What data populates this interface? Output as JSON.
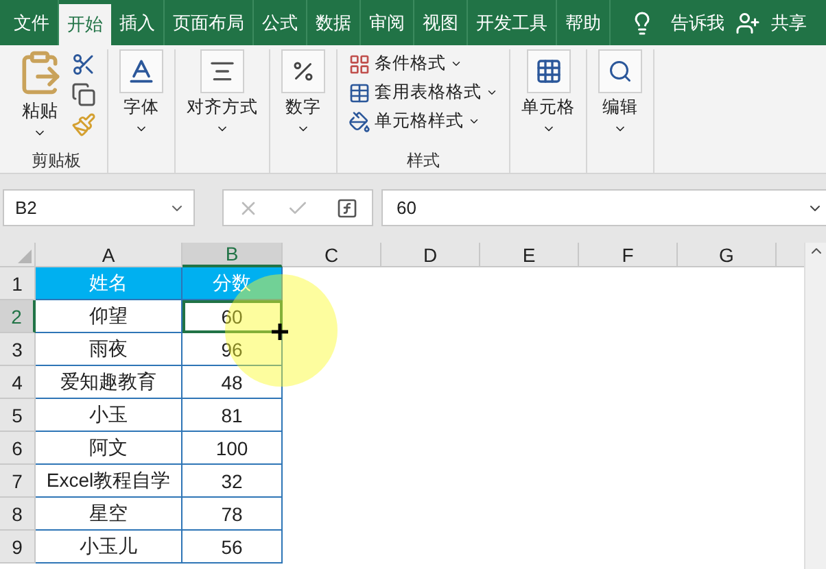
{
  "tabs": [
    {
      "label": "文件",
      "selected": false
    },
    {
      "label": "开始",
      "selected": true
    },
    {
      "label": "插入",
      "selected": false
    },
    {
      "label": "页面布局",
      "selected": false
    },
    {
      "label": "公式",
      "selected": false
    },
    {
      "label": "数据",
      "selected": false
    },
    {
      "label": "审阅",
      "selected": false
    },
    {
      "label": "视图",
      "selected": false
    },
    {
      "label": "开发工具",
      "selected": false
    },
    {
      "label": "帮助",
      "selected": false
    }
  ],
  "tell_me": "告诉我",
  "share": "共享",
  "ribbon": {
    "groups": [
      {
        "kind": "clipboard",
        "paste": "粘贴",
        "label": "剪贴板"
      },
      {
        "kind": "big",
        "label": "字体"
      },
      {
        "kind": "big",
        "label": "对齐方式"
      },
      {
        "kind": "big",
        "label": "数字"
      },
      {
        "kind": "styles",
        "items": [
          "条件格式",
          "套用表格格式",
          "单元格样式"
        ],
        "label": "样式"
      },
      {
        "kind": "big",
        "label": "单元格"
      },
      {
        "kind": "big",
        "label": "编辑"
      }
    ]
  },
  "name_box": "B2",
  "formula": "60",
  "columns": [
    {
      "label": "A",
      "selected": false
    },
    {
      "label": "B",
      "selected": true
    },
    {
      "label": "C",
      "selected": false
    },
    {
      "label": "D",
      "selected": false
    },
    {
      "label": "E",
      "selected": false
    },
    {
      "label": "F",
      "selected": false
    },
    {
      "label": "G",
      "selected": false
    }
  ],
  "rows": [
    {
      "number": "1",
      "kind": "header",
      "selected": false,
      "cells": [
        {
          "text": "姓名",
          "selected": false
        },
        {
          "text": "分数",
          "selected": false
        }
      ]
    },
    {
      "number": "2",
      "kind": "data",
      "selected": true,
      "cells": [
        {
          "text": "仰望",
          "selected": false
        },
        {
          "text": "60",
          "selected": true
        }
      ]
    },
    {
      "number": "3",
      "kind": "data",
      "selected": false,
      "cells": [
        {
          "text": "雨夜",
          "selected": false
        },
        {
          "text": "96",
          "selected": false
        }
      ]
    },
    {
      "number": "4",
      "kind": "data",
      "selected": false,
      "cells": [
        {
          "text": "爱知趣教育",
          "selected": false
        },
        {
          "text": "48",
          "selected": false
        }
      ]
    },
    {
      "number": "5",
      "kind": "data",
      "selected": false,
      "cells": [
        {
          "text": "小玉",
          "selected": false
        },
        {
          "text": "81",
          "selected": false
        }
      ]
    },
    {
      "number": "6",
      "kind": "data",
      "selected": false,
      "cells": [
        {
          "text": "阿文",
          "selected": false
        },
        {
          "text": "100",
          "selected": false
        }
      ]
    },
    {
      "number": "7",
      "kind": "data",
      "selected": false,
      "cells": [
        {
          "text": "Excel教程自学",
          "selected": false
        },
        {
          "text": "32",
          "selected": false
        }
      ]
    },
    {
      "number": "8",
      "kind": "data",
      "selected": false,
      "cells": [
        {
          "text": "星空",
          "selected": false
        },
        {
          "text": "78",
          "selected": false
        }
      ]
    },
    {
      "number": "9",
      "kind": "data",
      "selected": false,
      "cells": [
        {
          "text": "小玉儿",
          "selected": false
        },
        {
          "text": "56",
          "selected": false
        }
      ]
    }
  ]
}
